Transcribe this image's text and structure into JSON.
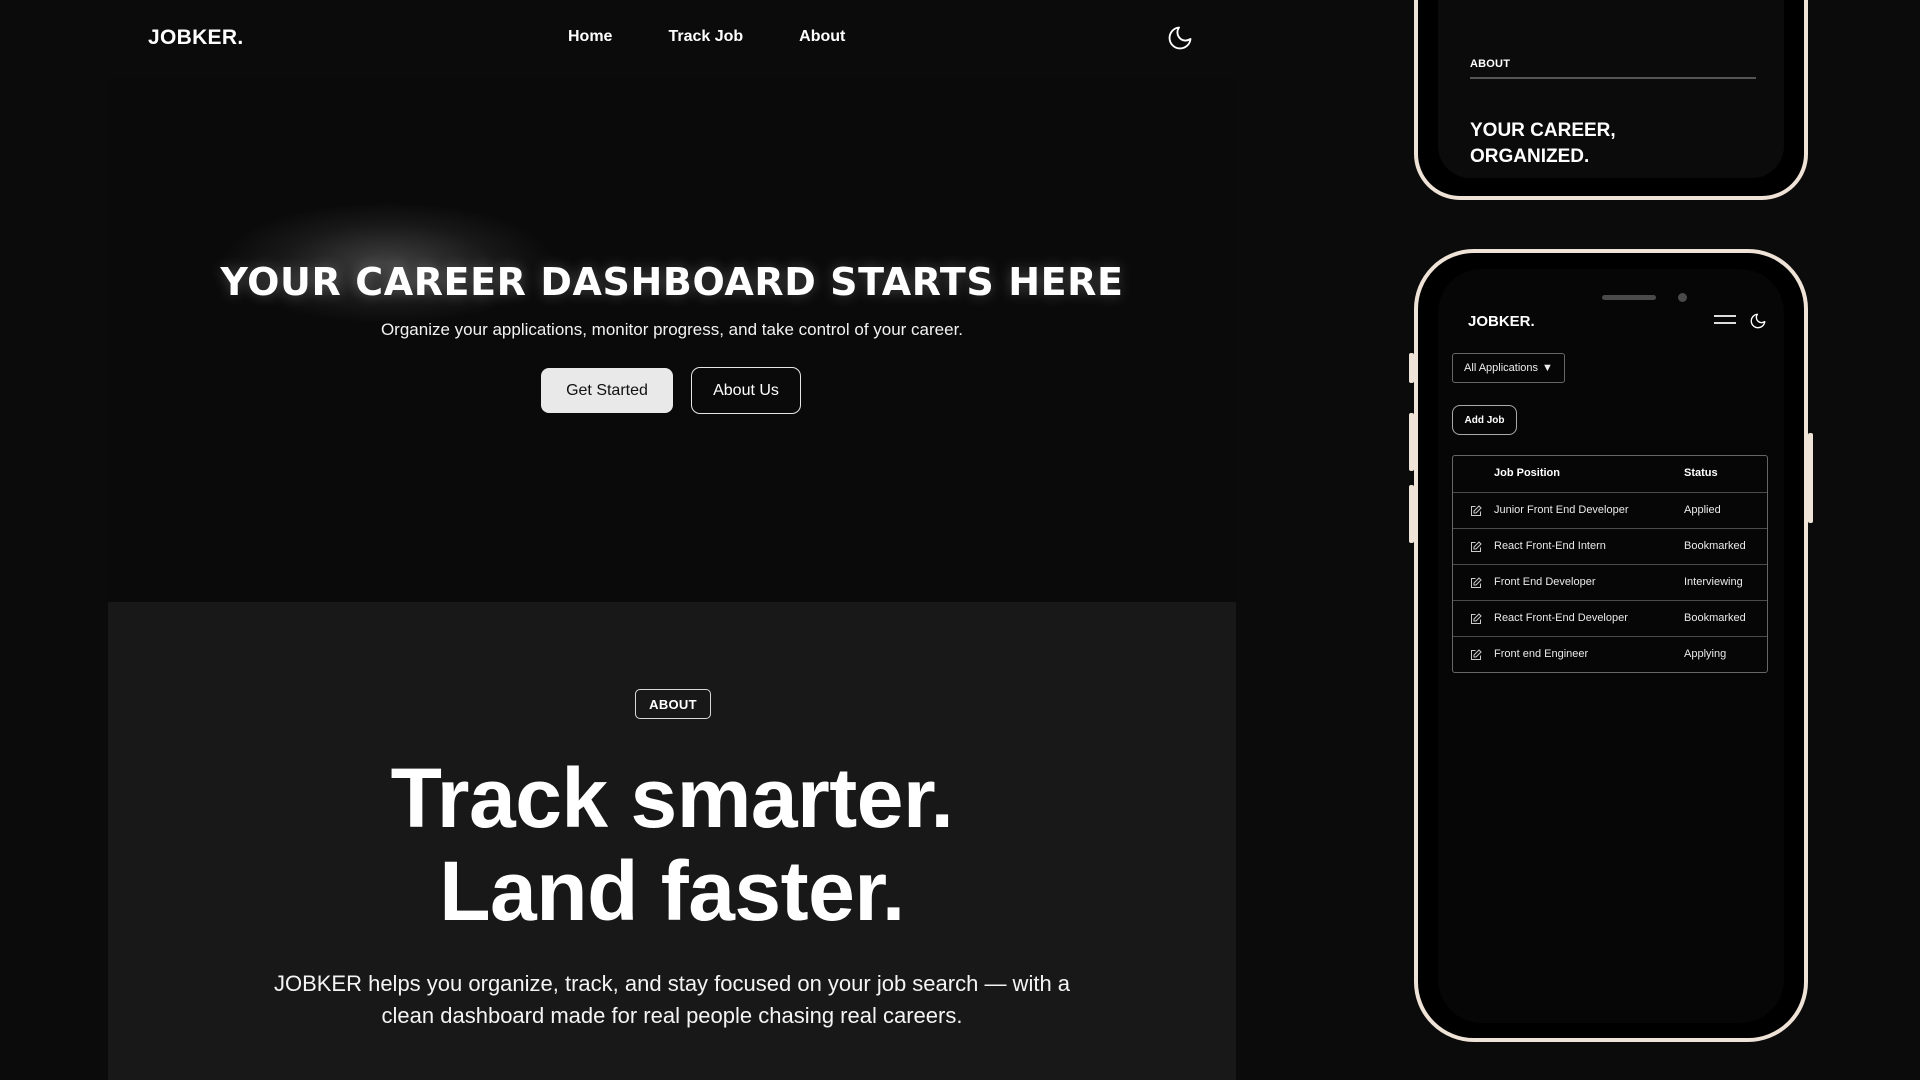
{
  "desktop": {
    "nav": {
      "logo": "JOBKER.",
      "links": [
        "Home",
        "Track Job",
        "About"
      ],
      "theme_icon": "moon-icon"
    },
    "hero": {
      "title": "YOUR CAREER DASHBOARD STARTS HERE",
      "subtitle": "Organize your applications, monitor progress, and take control of your career.",
      "primary_button": "Get Started",
      "secondary_button": "About Us"
    },
    "about": {
      "badge": "ABOUT",
      "title_line1": "Track smarter.",
      "title_line2": "Land faster.",
      "text": "JOBKER helps you organize, track, and stay focused on your job search — with a clean dashboard made for real people chasing real careers."
    }
  },
  "phone_top": {
    "label": "ABOUT",
    "title_line1": "YOUR CAREER,",
    "title_line2": "ORGANIZED."
  },
  "phone_main": {
    "logo": "JOBKER.",
    "menu_icon": "hamburger-icon",
    "theme_icon": "moon-icon",
    "filter_select": "All Applications",
    "filter_arrow": "▼",
    "add_button": "Add Job",
    "table": {
      "headers": [
        "Job Position",
        "Status"
      ],
      "rows": [
        {
          "position": "Junior Front End Developer",
          "status": "Applied"
        },
        {
          "position": "React Front-End Intern",
          "status": "Bookmarked"
        },
        {
          "position": "Front End Developer",
          "status": "Interviewing"
        },
        {
          "position": "React Front-End Developer",
          "status": "Bookmarked"
        },
        {
          "position": "Front end Engineer",
          "status": "Applying"
        }
      ]
    }
  },
  "colors": {
    "background": "#0b0b0b",
    "about_section": "#181818",
    "phone_frame": "#efe2d6",
    "primary_button": "#e9e9e9"
  }
}
